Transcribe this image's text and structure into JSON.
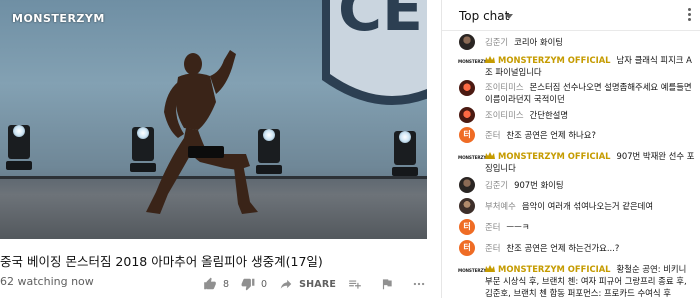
{
  "video": {
    "watermark": "MONSTERZYM",
    "title": "중국 베이징 몬스터짐 2018 아마추어 올림피아 생중계(17일)",
    "watching": "62 watching now"
  },
  "actions": {
    "like_count": "8",
    "dislike_count": "0",
    "share_label": "SHARE"
  },
  "chat": {
    "header": "Top chat",
    "messages": [
      {
        "name": "김준기",
        "text": "코리아 화이팅",
        "avatar": "dark"
      },
      {
        "name": "MONSTERZYM OFFICIAL",
        "text": "남자 클래식 피지크 A조 파이널입니다",
        "avatar": "brand",
        "owner": true
      },
      {
        "name": "조이티미스",
        "text": "몬스터짐 선수나오면 설명좀해주세요 예를들면이름이라던지 국적이던",
        "avatar": "red"
      },
      {
        "name": "조이티미스",
        "text": "간단한설명",
        "avatar": "red"
      },
      {
        "name": "준터",
        "text": "찬조 공연은 언제 하나요?",
        "avatar": "orange",
        "initial": "터"
      },
      {
        "name": "MONSTERZYM OFFICIAL",
        "text": "907번 박재완 선수 포징입니다",
        "avatar": "brand",
        "owner": true
      },
      {
        "name": "김준기",
        "text": "907번 화이팅",
        "avatar": "dark"
      },
      {
        "name": "부처예수",
        "text": "음악이 여러개 섞여나오는거 같은데여",
        "avatar": "dark2"
      },
      {
        "name": "준터",
        "text": "ㅡㅡㅋ",
        "avatar": "orange",
        "initial": "터"
      },
      {
        "name": "준터",
        "text": "찬조 공연은 언제 하는건가요...?",
        "avatar": "orange",
        "initial": "터"
      },
      {
        "name": "MONSTERZYM OFFICIAL",
        "text": "황철순 공연: 비키니 부문 시상식 후, 브랜치 첸: 여자 피규어 그랑프리 종료 후, 김준호, 브랜치 첸 합동 퍼포먼스: 프로카드 수여식 후",
        "avatar": "brand",
        "owner": true
      }
    ]
  },
  "colors": {
    "owner_name": "#c59b00",
    "author_name": "#888888",
    "accent_orange": "#ef6c25"
  }
}
